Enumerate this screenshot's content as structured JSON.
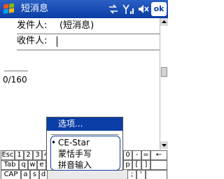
{
  "titlebar": {
    "app_title": "短消息",
    "ok_label": "ok",
    "start_icon": "windows-flag-icon",
    "tray_icons": [
      "connectivity-arrows-icon",
      "signal-strength-icon",
      "speaker-icon"
    ]
  },
  "compose": {
    "from_label": "发件人:",
    "from_value": "(短消息)",
    "to_label": "收件人:",
    "to_value": "",
    "char_counter": "0/160"
  },
  "menu": {
    "header": "选项...",
    "items": [
      {
        "label": "CE-Star",
        "selected": true
      },
      {
        "label": "蒙恬手写",
        "selected": false
      },
      {
        "label": "拼音输入",
        "selected": false
      }
    ]
  },
  "keyboard": {
    "row1": [
      "Esc",
      "1",
      "2",
      "3",
      "4",
      "0",
      "-",
      "=",
      "←"
    ],
    "row2": [
      "Tab",
      "q",
      "w",
      "e",
      "p",
      "[",
      "]"
    ],
    "row3": [
      "CAP",
      "a",
      "s",
      "d",
      ";",
      "'"
    ]
  },
  "colors": {
    "titlebar": "#0b3ea6",
    "menu_header": "#0b3ea6",
    "keyboard_bg": "#eaeaea"
  }
}
